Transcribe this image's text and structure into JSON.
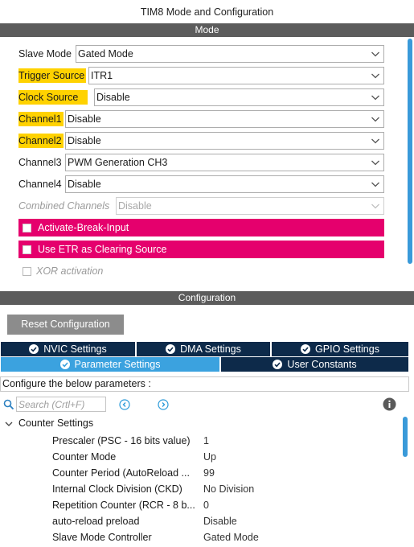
{
  "window": {
    "title": "TIM8 Mode and Configuration"
  },
  "mode": {
    "header": "Mode",
    "fields": [
      {
        "label": "Slave Mode",
        "value": "Gated Mode"
      },
      {
        "label": "Trigger Source",
        "value": "ITR1"
      },
      {
        "label": "Clock Source",
        "value": "Disable"
      },
      {
        "label": "Channel1",
        "value": "Disable"
      },
      {
        "label": "Channel2",
        "value": "Disable"
      },
      {
        "label": "Channel3",
        "value": "PWM Generation CH3"
      },
      {
        "label": "Channel4",
        "value": "Disable"
      },
      {
        "label": "Combined Channels",
        "value": "Disable"
      }
    ],
    "checkboxes": [
      {
        "label": "Activate-Break-Input"
      },
      {
        "label": "Use ETR as Clearing Source"
      }
    ],
    "xor": {
      "label": "XOR activation"
    },
    "highlight_color": "#ffd200",
    "warning_color": "#e5006d"
  },
  "configuration": {
    "header": "Configuration",
    "reset_label": "Reset Configuration",
    "tabs_row1": [
      {
        "label": "NVIC Settings"
      },
      {
        "label": "DMA Settings"
      },
      {
        "label": "GPIO Settings"
      }
    ],
    "tabs_row2": [
      {
        "label": "Parameter Settings",
        "active": true
      },
      {
        "label": "User Constants",
        "active": false
      }
    ],
    "configure_text": "Configure the below parameters :",
    "search": {
      "placeholder": "Search (Crtl+F)"
    },
    "group": {
      "title": "Counter Settings",
      "params": [
        {
          "name": "Prescaler (PSC - 16 bits value)",
          "value": "1"
        },
        {
          "name": "Counter Mode",
          "value": "Up"
        },
        {
          "name": "Counter Period (AutoReload ...",
          "value": "99"
        },
        {
          "name": "Internal Clock Division (CKD)",
          "value": "No Division"
        },
        {
          "name": "Repetition Counter (RCR - 8 b...",
          "value": "0"
        },
        {
          "name": "auto-reload preload",
          "value": "Disable"
        },
        {
          "name": "Slave Mode Controller",
          "value": "Gated Mode"
        }
      ]
    }
  }
}
